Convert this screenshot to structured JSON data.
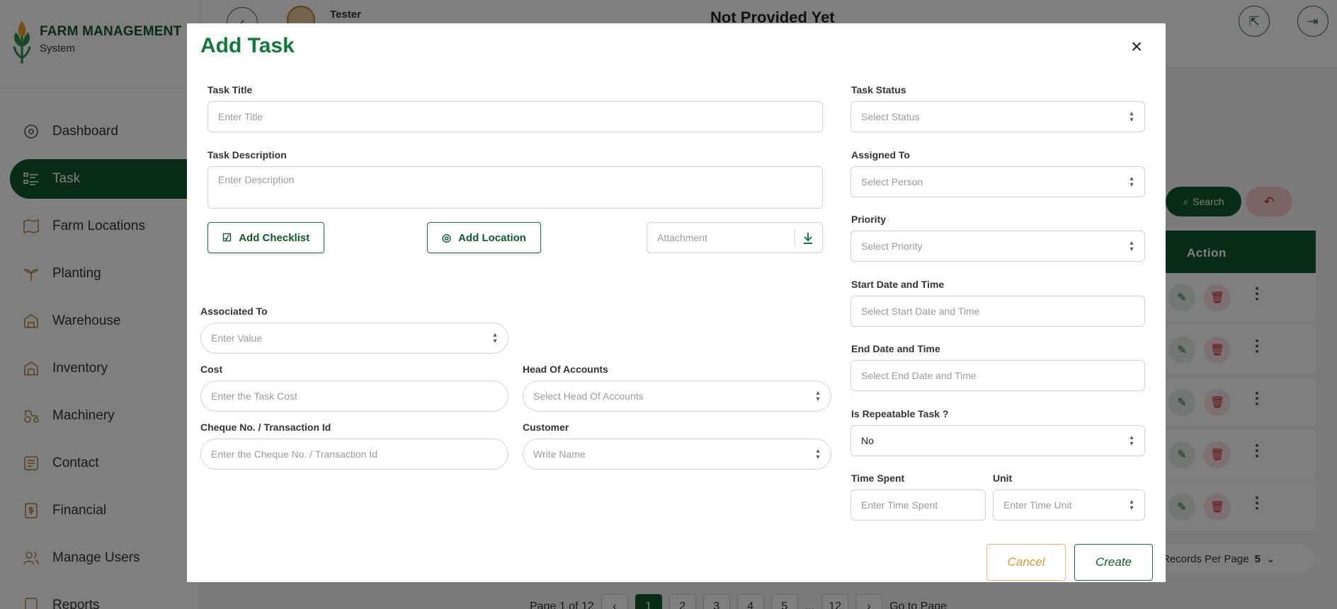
{
  "app": {
    "brand_title": "FARM MANAGEMENT",
    "brand_subtitle": "System"
  },
  "sidebar": {
    "items": [
      {
        "label": "Dashboard",
        "icon": "dashboard-icon",
        "active": false
      },
      {
        "label": "Task",
        "icon": "task-list-icon",
        "active": true
      },
      {
        "label": "Farm Locations",
        "icon": "map-icon",
        "active": false
      },
      {
        "label": "Planting",
        "icon": "plant-icon",
        "active": false
      },
      {
        "label": "Warehouse",
        "icon": "warehouse-icon",
        "active": false
      },
      {
        "label": "Inventory",
        "icon": "inventory-icon",
        "active": false
      },
      {
        "label": "Machinery",
        "icon": "tractor-icon",
        "active": false
      },
      {
        "label": "Contact",
        "icon": "contact-icon",
        "active": false
      },
      {
        "label": "Financial",
        "icon": "financial-icon",
        "active": false
      },
      {
        "label": "Manage Users",
        "icon": "users-icon",
        "active": false
      },
      {
        "label": "Reports",
        "icon": "reports-icon",
        "active": false
      }
    ]
  },
  "header": {
    "user_name": "Tester",
    "page_heading": "Not Provided Yet"
  },
  "background": {
    "search_label": "Search",
    "table_action_header": "Action",
    "records_per_page_label": "Records Per Page",
    "records_per_page_value": "5",
    "pagination": {
      "page_info": "Page 1 of 12",
      "pages": [
        "1",
        "2",
        "3",
        "4",
        "5",
        "...",
        "12"
      ],
      "current": "1",
      "go_to_label": "Go to Page"
    }
  },
  "modal": {
    "title": "Add Task",
    "task_title": {
      "label": "Task Title",
      "placeholder": "Enter Title",
      "value": ""
    },
    "task_description": {
      "label": "Task Description",
      "placeholder": "Enter Description",
      "value": ""
    },
    "add_checklist_label": "Add Checklist",
    "add_location_label": "Add Location",
    "attachment_placeholder": "Attachment",
    "associated_to": {
      "label": "Associated To",
      "placeholder": "Enter Value"
    },
    "cost": {
      "label": "Cost",
      "placeholder": "Enter the Task Cost"
    },
    "head_of_accounts": {
      "label": "Head Of Accounts",
      "placeholder": "Select Head Of Accounts"
    },
    "cheque": {
      "label": "Cheque No. / Transaction Id",
      "placeholder": "Enter the Cheque No. / Transaction Id"
    },
    "customer": {
      "label": "Customer",
      "placeholder": "Write Name"
    },
    "task_status": {
      "label": "Task Status",
      "placeholder": "Select Status"
    },
    "assigned_to": {
      "label": "Assigned To",
      "placeholder": "Select Person"
    },
    "priority": {
      "label": "Priority",
      "placeholder": "Select Priority"
    },
    "start_date": {
      "label": "Start Date and Time",
      "placeholder": "Select Start Date and Time"
    },
    "end_date": {
      "label": "End Date and Time",
      "placeholder": "Select End Date and Time"
    },
    "repeatable": {
      "label": "Is Repeatable Task ?",
      "value": "No"
    },
    "time_spent": {
      "label": "Time Spent",
      "placeholder": "Enter Time Spent"
    },
    "unit": {
      "label": "Unit",
      "placeholder": "Enter Time Unit"
    },
    "cancel_label": "Cancel",
    "create_label": "Create"
  },
  "colors": {
    "brand_green": "#0f5b2f",
    "title_green": "#0f7a3a",
    "cancel_gold": "#d49a2f",
    "danger_red": "#c62828"
  }
}
